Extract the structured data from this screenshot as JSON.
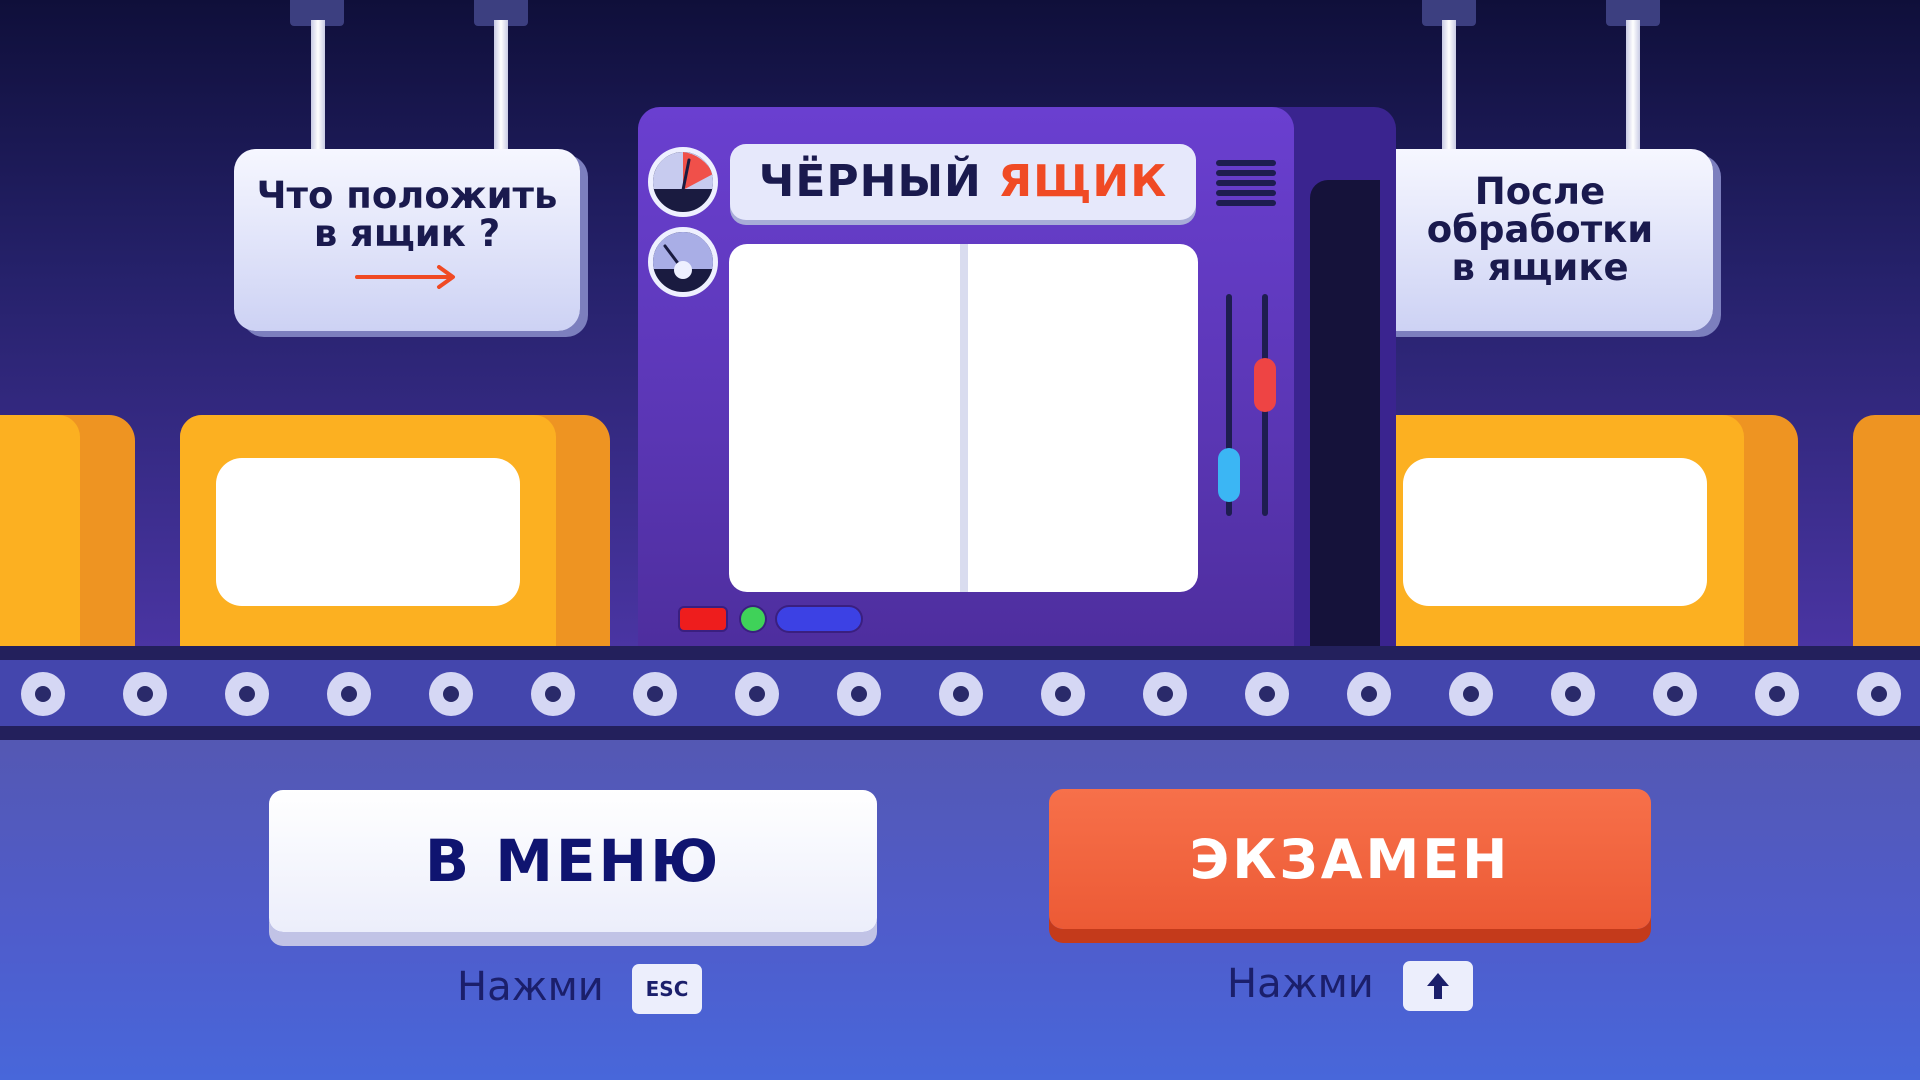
{
  "signs": {
    "input": {
      "lines": [
        "Что положить",
        "в ящик ?"
      ],
      "arrow_icon": "arrow-right-icon"
    },
    "output": {
      "lines": [
        "После",
        "обработки",
        "в ящике"
      ]
    }
  },
  "machine": {
    "title_main": "ЧЁРНЫЙ",
    "title_accent": "ЯЩИК",
    "screen_left": "",
    "screen_right": "",
    "colors": {
      "body": "#6a3fd0",
      "accent": "#f04a24"
    }
  },
  "boxes": {
    "input_value": "",
    "output_value": ""
  },
  "buttons": {
    "menu": {
      "label": "В МЕНЮ",
      "hint": "Нажми",
      "key": "ESC"
    },
    "exam": {
      "label": "ЭКЗАМЕН",
      "hint": "Нажми",
      "key_icon": "arrow-up-icon"
    }
  },
  "colors": {
    "primary_button": "#ec5a35",
    "secondary_button": "#ffffff",
    "text_dark": "#0f1470"
  }
}
